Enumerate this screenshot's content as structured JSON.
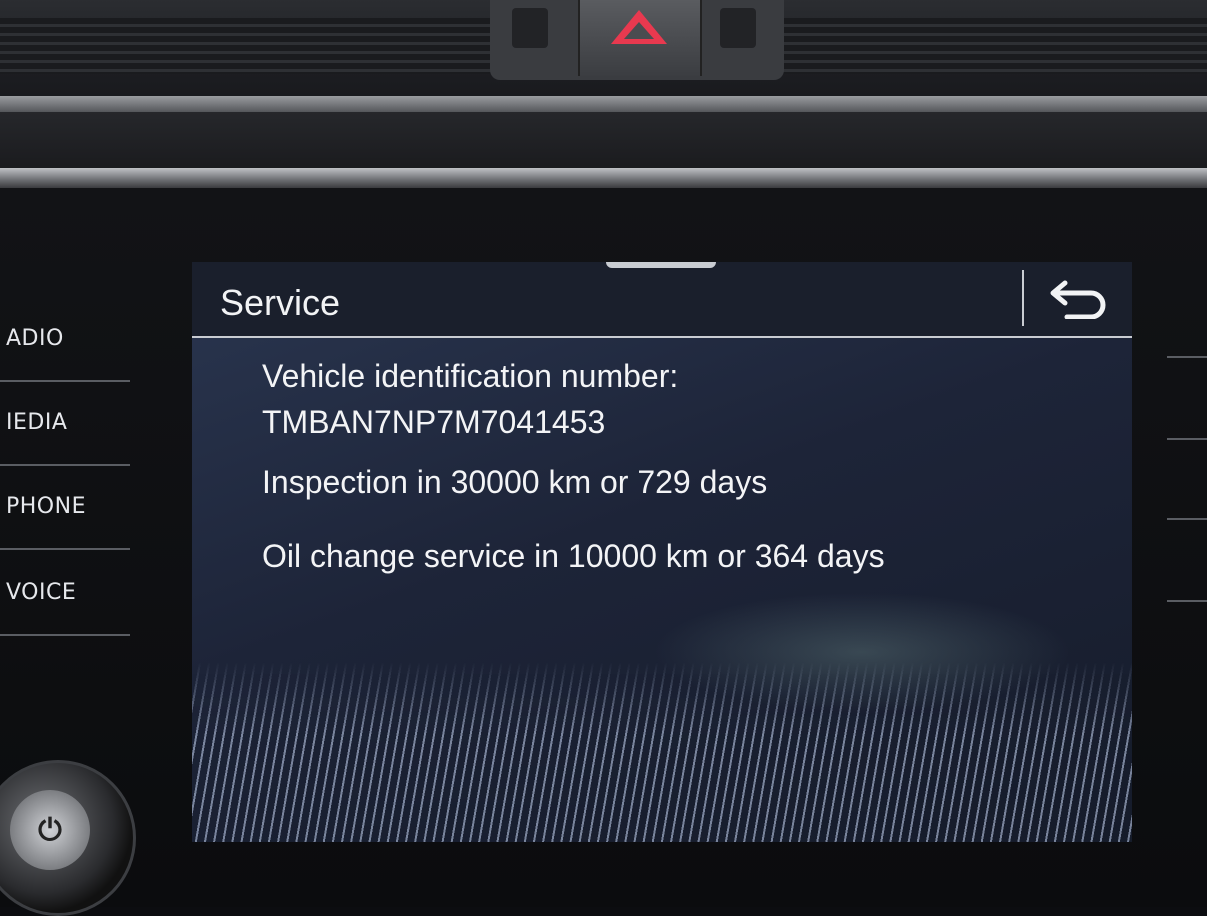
{
  "side_menu": {
    "items": [
      {
        "label": "ADIO"
      },
      {
        "label": "IEDIA"
      },
      {
        "label": "PHONE"
      },
      {
        "label": "VOICE"
      }
    ]
  },
  "screen": {
    "title": "Service",
    "back_icon": "back-arrow-icon",
    "vin_label": "Vehicle identification number:",
    "vin_value": "TMBAN7NP7M7041453",
    "inspection": "Inspection in 30000 km or 729 days",
    "oil_change": "Oil change service in 10000 km or 364 days"
  },
  "colors": {
    "hazard": "#e8394f",
    "screen_bg": "#1d2438",
    "text": "#f3f4f6"
  }
}
